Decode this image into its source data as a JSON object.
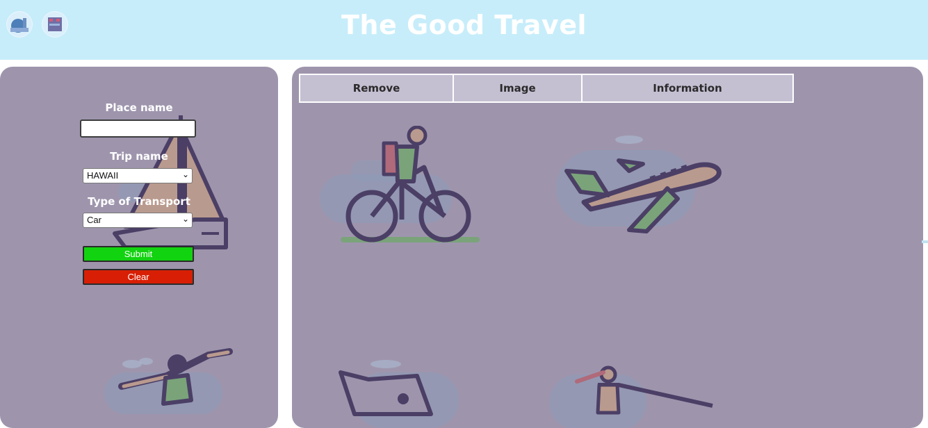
{
  "header": {
    "title": "The Good Travel",
    "logos": [
      {
        "icon": "globe-city-logo-icon"
      },
      {
        "icon": "building-logo-icon"
      }
    ],
    "colors": {
      "background": "#c7edfa",
      "title": "#ffffff"
    }
  },
  "form": {
    "place_label": "Place name",
    "place_value": "",
    "trip_label": "Trip name",
    "trip_selected": "HAWAII",
    "transport_label": "Type of Transport",
    "transport_selected": "Car",
    "submit_label": "Submit",
    "clear_label": "Clear",
    "colors": {
      "submit": "#12d310",
      "clear": "#d81f05",
      "panel": "#9e95ad"
    }
  },
  "table": {
    "headers": [
      "Remove",
      "Image",
      "Information"
    ],
    "header_background": "#c5bfd2"
  },
  "decorations": [
    "sailboat-icon",
    "surfer-icon",
    "cyclist-icon",
    "airplane-icon",
    "car-icon",
    "water-skier-icon"
  ]
}
